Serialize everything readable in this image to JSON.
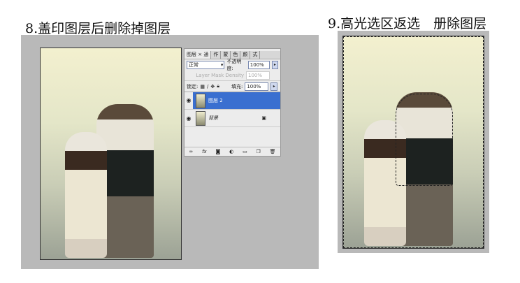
{
  "step8": {
    "title": "8.盖印图层后删除掉图层"
  },
  "step9": {
    "title": "9.高光选区返选　册除图层"
  },
  "layers_panel": {
    "tabs": [
      "图层",
      "×",
      "通",
      "作",
      "蒙",
      "色",
      "颜",
      "式"
    ],
    "blend_mode": "正常",
    "opacity_label": "不透明度:",
    "opacity_value": "100%",
    "mask_density_label": "Layer Mask Density",
    "mask_density_value": "100%",
    "lock_label": "锁定:",
    "fill_label": "填充:",
    "fill_value": "100%",
    "layers": [
      {
        "name": "图层 2",
        "selected": true
      },
      {
        "name": "背景",
        "locked": true
      }
    ],
    "footer_icons": [
      "link-icon",
      "fx-icon",
      "mask-icon",
      "adjustment-icon",
      "folder-icon",
      "new-layer-icon",
      "trash-icon"
    ]
  }
}
